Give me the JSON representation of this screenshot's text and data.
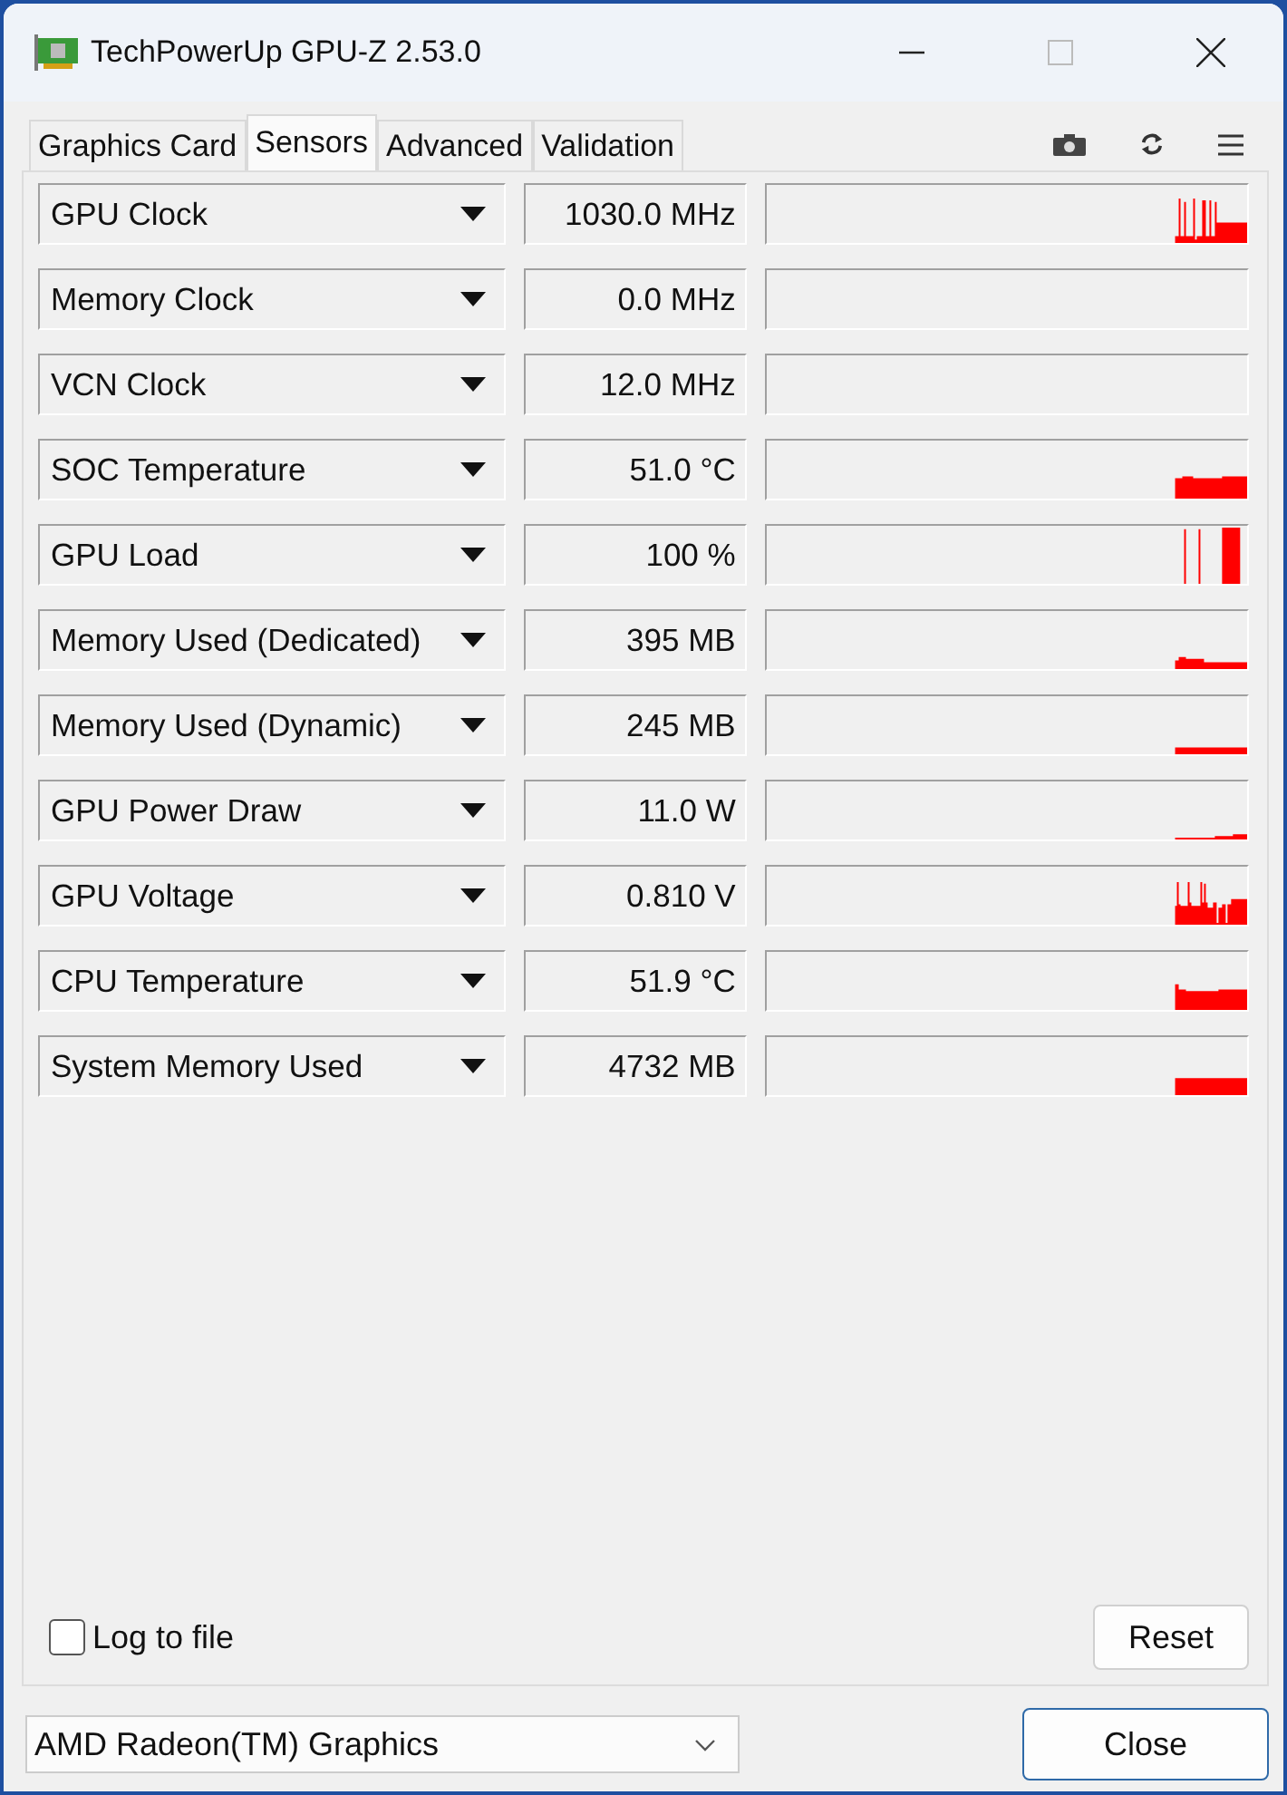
{
  "window": {
    "title": "TechPowerUp GPU-Z 2.53.0"
  },
  "tabs": [
    {
      "label": "Graphics Card",
      "selected": false
    },
    {
      "label": "Sensors",
      "selected": true
    },
    {
      "label": "Advanced",
      "selected": false
    },
    {
      "label": "Validation",
      "selected": false
    }
  ],
  "sensors": [
    {
      "name": "GPU Clock",
      "value": "1030.0 MHz"
    },
    {
      "name": "Memory Clock",
      "value": "0.0 MHz"
    },
    {
      "name": "VCN Clock",
      "value": "12.0 MHz"
    },
    {
      "name": "SOC Temperature",
      "value": "51.0 °C"
    },
    {
      "name": "GPU Load",
      "value": "100 %"
    },
    {
      "name": "Memory Used (Dedicated)",
      "value": "395 MB"
    },
    {
      "name": "Memory Used (Dynamic)",
      "value": "245 MB"
    },
    {
      "name": "GPU Power Draw",
      "value": "11.0 W"
    },
    {
      "name": "GPU Voltage",
      "value": "0.810 V"
    },
    {
      "name": "CPU Temperature",
      "value": "51.9 °C"
    },
    {
      "name": "System Memory Used",
      "value": "4732 MB"
    }
  ],
  "log_to_file": {
    "label": "Log to file",
    "checked": false
  },
  "reset_button": "Reset",
  "device_select": {
    "value": "AMD Radeon(TM) Graphics"
  },
  "close_button": "Close"
}
